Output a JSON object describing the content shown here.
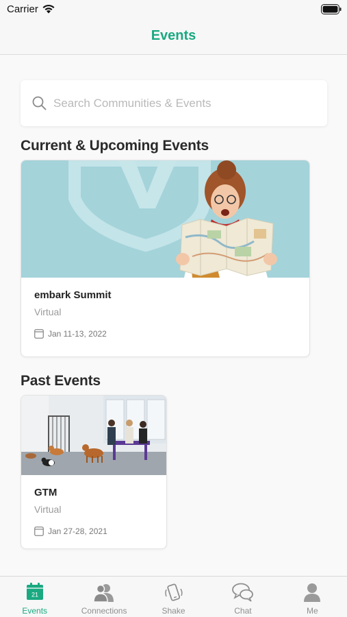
{
  "status_bar": {
    "carrier": "Carrier"
  },
  "nav": {
    "title": "Events"
  },
  "search": {
    "placeholder": "Search Communities & Events",
    "value": ""
  },
  "sections": {
    "current_title": "Current & Upcoming Events",
    "past_title": "Past Events"
  },
  "events_current": [
    {
      "name": "embark Summit",
      "location": "Virtual",
      "date": "Jan 11-13, 2022"
    }
  ],
  "events_past": [
    {
      "name": "GTM",
      "location": "Virtual",
      "date": "Jan 27-28, 2021"
    }
  ],
  "tabs": [
    {
      "label": "Events",
      "icon": "calendar-icon",
      "badge": "21",
      "active": true
    },
    {
      "label": "Connections",
      "icon": "people-icon",
      "active": false
    },
    {
      "label": "Shake",
      "icon": "shake-phone-icon",
      "active": false
    },
    {
      "label": "Chat",
      "icon": "chat-bubbles-icon",
      "active": false
    },
    {
      "label": "Me",
      "icon": "person-icon",
      "active": false
    }
  ],
  "colors": {
    "accent": "#1aa981",
    "banner_bg": "#9fd0d8",
    "inactive": "#8e8e8e"
  }
}
